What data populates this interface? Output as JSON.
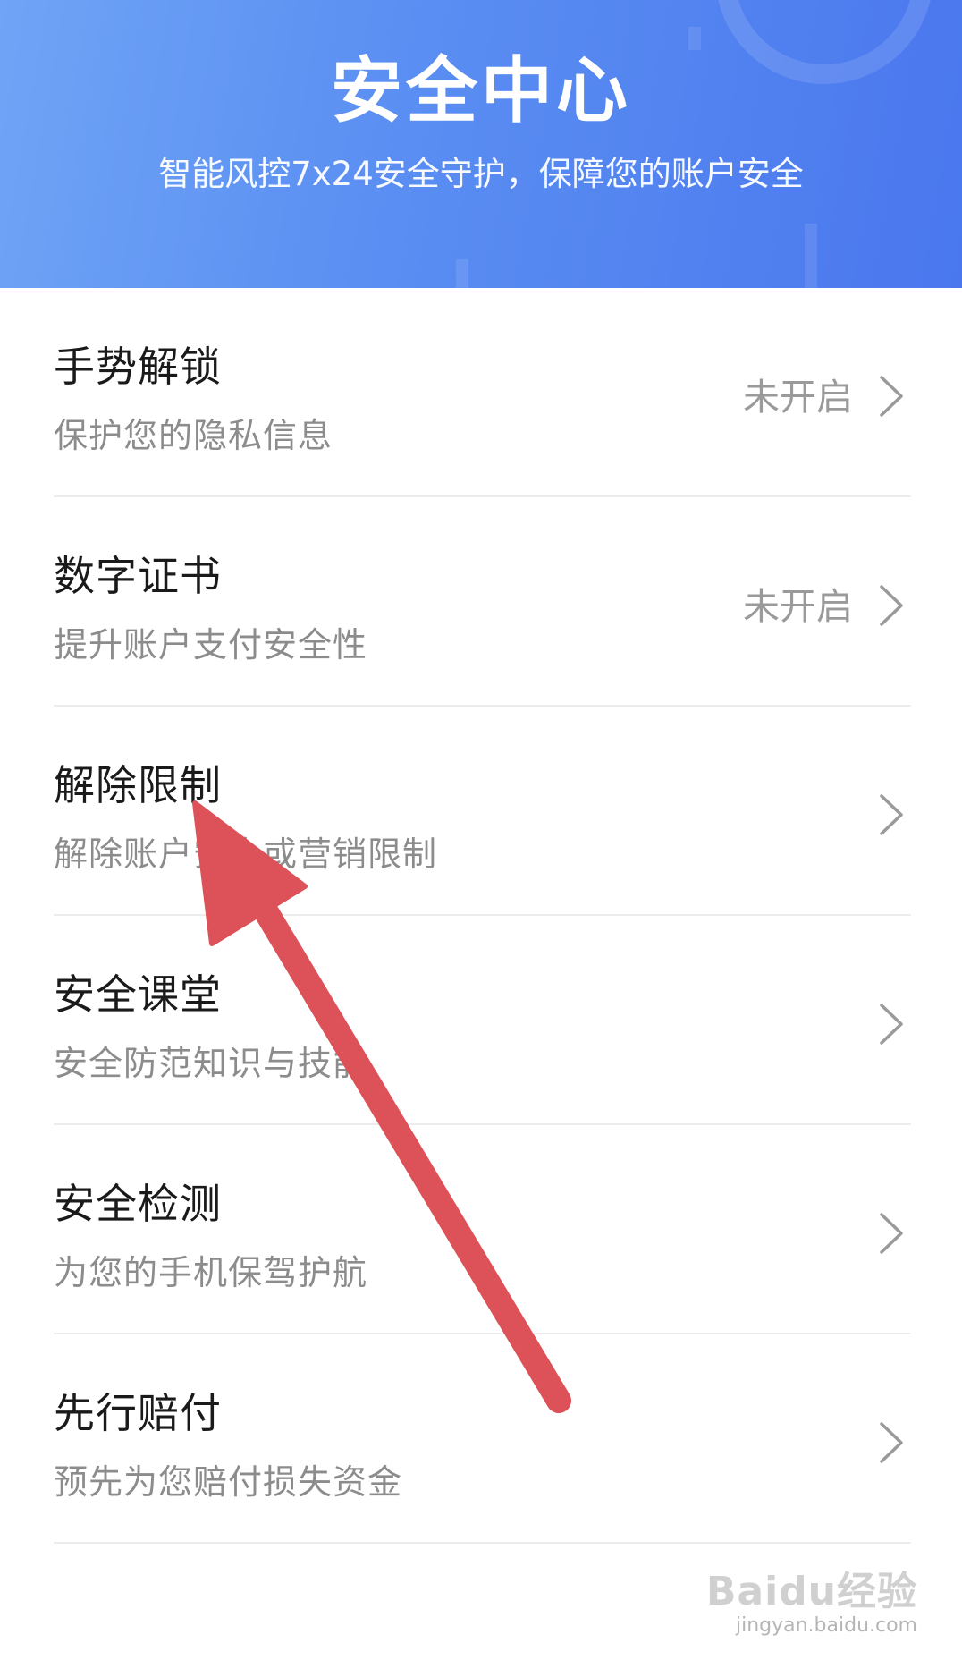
{
  "header": {
    "title": "安全中心",
    "subtitle": "智能风控7x24安全守护，保障您的账户安全"
  },
  "items": [
    {
      "title": "手势解锁",
      "desc": "保护您的隐私信息",
      "status": "未开启"
    },
    {
      "title": "数字证书",
      "desc": "提升账户支付安全性",
      "status": "未开启"
    },
    {
      "title": "解除限制",
      "desc": "解除账户安全或营销限制",
      "status": ""
    },
    {
      "title": "安全课堂",
      "desc": "安全防范知识与技能",
      "status": ""
    },
    {
      "title": "安全检测",
      "desc": "为您的手机保驾护航",
      "status": ""
    },
    {
      "title": "先行赔付",
      "desc": "预先为您赔付损失资金",
      "status": ""
    }
  ],
  "watermark": {
    "logo": "Baidu经验",
    "url": "jingyan.baidu.com"
  },
  "colors": {
    "header_start": "#6fa4f6",
    "header_end": "#4a77ee",
    "arrow": "#dc5258"
  },
  "icons": {
    "chevron": "chevron-right-icon",
    "annotation": "red-arrow-annotation"
  }
}
